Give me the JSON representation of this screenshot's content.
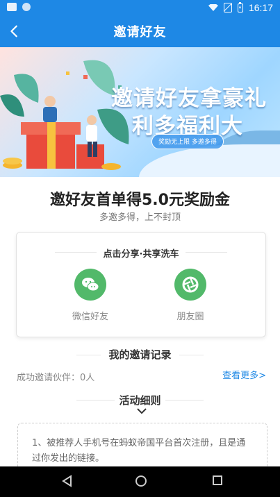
{
  "status_bar": {
    "time": "16:17"
  },
  "navbar": {
    "title": "邀请好友"
  },
  "banner": {
    "line1": "邀请好友拿豪礼",
    "line2": "利多福利大",
    "pill": "奖励无上限 多邀多得"
  },
  "headline": "邀好友首单得5.0元奖励金",
  "subline": "多邀多得，上不封顶",
  "share": {
    "title": "点击分享·共享洗车",
    "items": [
      {
        "label": "微信好友",
        "icon": "wechat-icon"
      },
      {
        "label": "朋友圈",
        "icon": "moments-icon"
      }
    ]
  },
  "records": {
    "title": "我的邀请记录",
    "success_text": "成功邀请伙伴：0人",
    "more_link": "查看更多>"
  },
  "rules": {
    "title": "活动细则",
    "text": "1、被推荐人手机号在蚂蚁帝国平台首次注册，且是通过你发出的链接。"
  },
  "colors": {
    "brand": "#1e88e5",
    "share_green": "#52b96a",
    "link": "#1e88e5"
  }
}
